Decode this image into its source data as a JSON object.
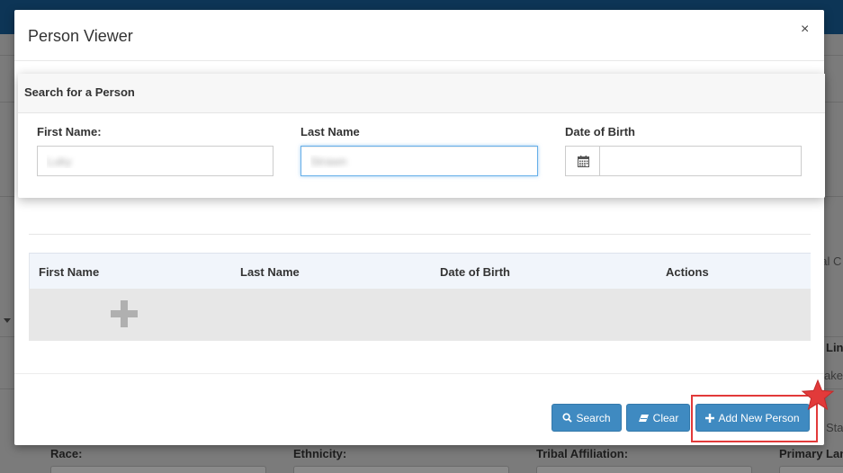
{
  "background": {
    "labels": [
      "Race:",
      "Ethnicity:",
      "Tribal Affiliation:",
      "Primary Lan"
    ],
    "peek_right": [
      "gal C",
      "Lin",
      "ake",
      "Sta"
    ]
  },
  "modal": {
    "title": "Person Viewer",
    "close_glyph": "×",
    "search": {
      "heading": "Search for a Person",
      "first_name_label": "First Name:",
      "first_name_value": "Luky",
      "last_name_label": "Last Name",
      "last_name_value": "Strawn",
      "dob_label": "Date of Birth",
      "dob_value": ""
    },
    "results": {
      "columns": [
        "First Name",
        "Last Name",
        "Date of Birth",
        "Actions"
      ],
      "empty_row_icon": "plus-icon"
    },
    "buttons": {
      "search": "Search",
      "clear": "Clear",
      "add_new_person": "Add New Person"
    }
  },
  "colors": {
    "topbar": "#0d3556",
    "button": "#3f8ac1",
    "highlight": "#e23a3a",
    "star": "#e23a3a"
  }
}
